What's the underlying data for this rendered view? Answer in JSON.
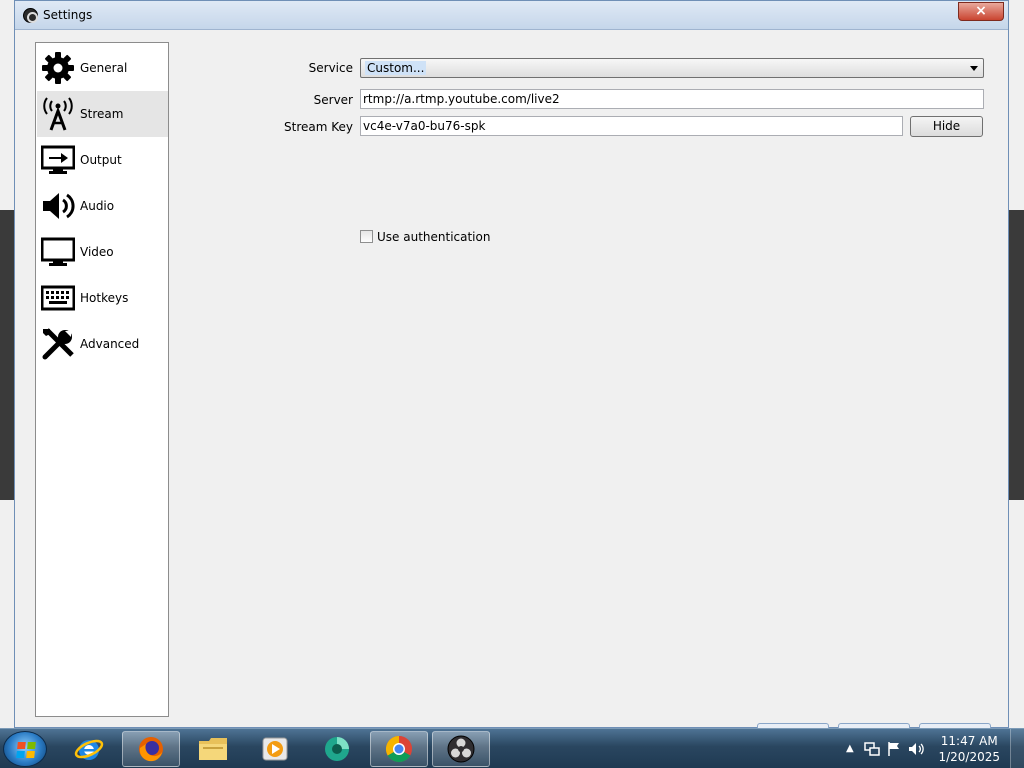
{
  "window": {
    "title": "Settings",
    "close_glyph": "×"
  },
  "sidebar": {
    "items": [
      {
        "label": "General",
        "icon": "gear-icon",
        "selected": false
      },
      {
        "label": "Stream",
        "icon": "broadcast-antenna-icon",
        "selected": true
      },
      {
        "label": "Output",
        "icon": "output-monitor-icon",
        "selected": false
      },
      {
        "label": "Audio",
        "icon": "speaker-icon",
        "selected": false
      },
      {
        "label": "Video",
        "icon": "monitor-icon",
        "selected": false
      },
      {
        "label": "Hotkeys",
        "icon": "keyboard-icon",
        "selected": false
      },
      {
        "label": "Advanced",
        "icon": "tools-icon",
        "selected": false
      }
    ]
  },
  "stream": {
    "service_label": "Service",
    "service_value": "Custom...",
    "server_label": "Server",
    "server_value": "rtmp://a.rtmp.youtube.com/live2",
    "stream_key_label": "Stream Key",
    "stream_key_value": "vc4e-v7a0-bu76-spk",
    "hide_button_label": "Hide",
    "use_auth_label": "Use authentication",
    "use_auth_checked": false
  },
  "taskbar": {
    "apps": [
      {
        "name": "internet-explorer-icon",
        "active": false
      },
      {
        "name": "firefox-icon",
        "active": true
      },
      {
        "name": "file-explorer-icon",
        "active": false
      },
      {
        "name": "media-player-icon",
        "active": false
      },
      {
        "name": "teal-app-icon",
        "active": false
      },
      {
        "name": "chrome-icon",
        "active": true
      },
      {
        "name": "obs-icon",
        "active": true
      }
    ],
    "clock_time": "11:47 AM",
    "clock_date": "1/20/2025"
  },
  "colors": {
    "accent": "#2a4660",
    "selected_item": "#e5e5e5",
    "close_button": "#c94430"
  }
}
